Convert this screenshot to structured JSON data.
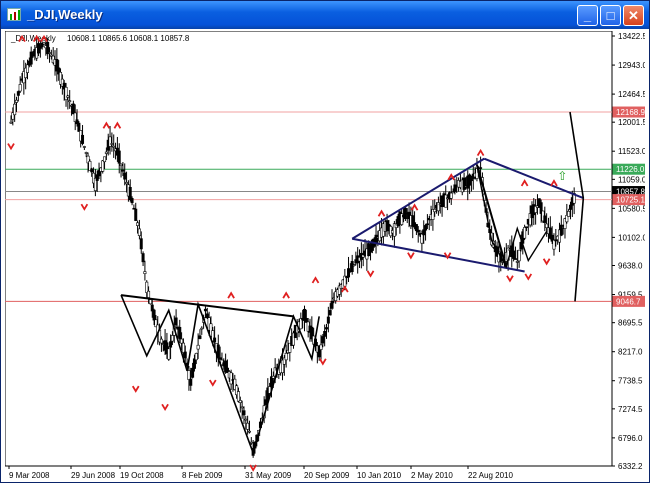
{
  "window": {
    "title": "_DJI,Weekly",
    "buttons": {
      "minimize": "_",
      "maximize": "□",
      "close": "✕"
    }
  },
  "chart_header": {
    "symbol": "_DJI,Weekly",
    "ohlc": "10608.1 10865.6 10608.1 10857.8"
  },
  "chart_data": {
    "type": "candlestick",
    "title": "_DJI,Weekly",
    "ylim": [
      6332.2,
      13500
    ],
    "y_ticks": [
      "13422.5",
      "12943.0",
      "12464.5",
      "12001.5",
      "11523.0",
      "11059.0",
      "10580.5",
      "10102.0",
      "9638.0",
      "9159.5",
      "8695.5",
      "8217.0",
      "7738.5",
      "7274.5",
      "6796.0",
      "6332.2"
    ],
    "x_ticks": [
      "9 Mar 2008",
      "29 Jun 2008",
      "19 Oct 2008",
      "8 Feb 2009",
      "31 May 2009",
      "20 Sep 2009",
      "10 Jan 2010",
      "2 May 2010",
      "22 Aug 2010"
    ],
    "price_markers": [
      {
        "value": "12168.9",
        "color": "#e06060"
      },
      {
        "value": "11226.0",
        "color": "#3aaa5a"
      },
      {
        "value": "10857.8",
        "color": "#000000"
      },
      {
        "value": "10725.1",
        "color": "#e06060"
      },
      {
        "value": "9046.7",
        "color": "#e06060"
      }
    ],
    "horizontal_lines": [
      {
        "y": 12168.9,
        "color": "#f0a0a0"
      },
      {
        "y": 11226.0,
        "color": "#3aaa5a"
      },
      {
        "y": 10857.8,
        "color": "#888888"
      },
      {
        "y": 10725.1,
        "color": "#f0a0a0"
      },
      {
        "y": 9046.7,
        "color": "#e06060"
      }
    ],
    "price_path": [
      [
        0,
        12000
      ],
      [
        3,
        12700
      ],
      [
        6,
        13100
      ],
      [
        9,
        13300
      ],
      [
        12,
        13000
      ],
      [
        15,
        12500
      ],
      [
        17,
        12200
      ],
      [
        19,
        11800
      ],
      [
        21,
        11400
      ],
      [
        23,
        11000
      ],
      [
        25,
        11300
      ],
      [
        27,
        11700
      ],
      [
        29,
        11500
      ],
      [
        31,
        11100
      ],
      [
        33,
        10700
      ],
      [
        35,
        10200
      ],
      [
        37,
        9300
      ],
      [
        39,
        8800
      ],
      [
        41,
        8400
      ],
      [
        43,
        8200
      ],
      [
        45,
        8700
      ],
      [
        47,
        8300
      ],
      [
        49,
        7700
      ],
      [
        51,
        8300
      ],
      [
        53,
        8900
      ],
      [
        55,
        8500
      ],
      [
        57,
        8100
      ],
      [
        59,
        7900
      ],
      [
        61,
        7700
      ],
      [
        63,
        7300
      ],
      [
        65,
        6900
      ],
      [
        66,
        6550
      ],
      [
        68,
        7000
      ],
      [
        70,
        7500
      ],
      [
        72,
        7900
      ],
      [
        74,
        8000
      ],
      [
        76,
        8300
      ],
      [
        78,
        8600
      ],
      [
        80,
        8800
      ],
      [
        82,
        8500
      ],
      [
        84,
        8200
      ],
      [
        86,
        8600
      ],
      [
        88,
        9100
      ],
      [
        90,
        9300
      ],
      [
        92,
        9500
      ],
      [
        94,
        9700
      ],
      [
        96,
        9800
      ],
      [
        98,
        9900
      ],
      [
        100,
        10100
      ],
      [
        102,
        10300
      ],
      [
        104,
        10200
      ],
      [
        106,
        10400
      ],
      [
        108,
        10500
      ],
      [
        110,
        10300
      ],
      [
        112,
        10100
      ],
      [
        114,
        10400
      ],
      [
        116,
        10600
      ],
      [
        118,
        10700
      ],
      [
        120,
        10800
      ],
      [
        122,
        11000
      ],
      [
        124,
        10950
      ],
      [
        126,
        11100
      ],
      [
        128,
        11250
      ],
      [
        130,
        10300
      ],
      [
        132,
        9900
      ],
      [
        134,
        9700
      ],
      [
        136,
        9900
      ],
      [
        138,
        9700
      ],
      [
        140,
        10200
      ],
      [
        142,
        10500
      ],
      [
        144,
        10650
      ],
      [
        146,
        10300
      ],
      [
        148,
        10000
      ],
      [
        150,
        10200
      ],
      [
        152,
        10500
      ],
      [
        154,
        10857
      ]
    ],
    "x_max": 160,
    "trendlines": [
      {
        "from": [
          30,
          9150
        ],
        "to": [
          77,
          8800
        ],
        "color": "#000000"
      },
      {
        "from": [
          93,
          10080
        ],
        "to": [
          129,
          11400
        ],
        "color": "#1a1a6e"
      },
      {
        "from": [
          93,
          10080
        ],
        "to": [
          140,
          9540
        ],
        "color": "#1a1a6e"
      },
      {
        "from": [
          129,
          11400
        ],
        "to": [
          156,
          10750
        ],
        "color": "#1a1a6e"
      },
      {
        "from": [
          127,
          11300
        ],
        "to": [
          135,
          9610
        ],
        "color": "#000000"
      }
    ]
  }
}
